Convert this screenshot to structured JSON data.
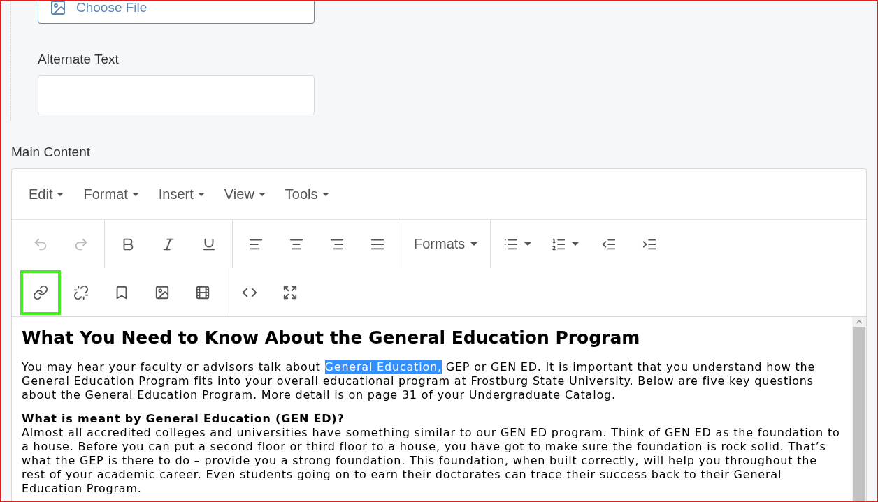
{
  "image_field": {
    "button": "Choose File"
  },
  "alt_text": {
    "label": "Alternate Text"
  },
  "main_content": {
    "label": "Main Content",
    "menubar": [
      {
        "label": "Edit"
      },
      {
        "label": "Format"
      },
      {
        "label": "Insert"
      },
      {
        "label": "View"
      },
      {
        "label": "Tools"
      }
    ],
    "toolbar_rows": [
      [
        [
          {
            "kind": "undo",
            "disabled": true,
            "highlighted": false
          },
          {
            "kind": "redo",
            "disabled": true,
            "highlighted": false
          }
        ],
        [
          {
            "kind": "bold",
            "disabled": false,
            "highlighted": false
          },
          {
            "kind": "italic",
            "disabled": false,
            "highlighted": false
          },
          {
            "kind": "underline",
            "disabled": false,
            "highlighted": false
          }
        ],
        [
          {
            "kind": "align-left",
            "disabled": false,
            "highlighted": false
          },
          {
            "kind": "align-center",
            "disabled": false,
            "highlighted": false
          },
          {
            "kind": "align-right",
            "disabled": false,
            "highlighted": false
          },
          {
            "kind": "align-justify",
            "disabled": false,
            "highlighted": false
          }
        ],
        [
          {
            "kind": "dropdown",
            "label": "Formats",
            "disabled": false,
            "highlighted": false
          }
        ],
        [
          {
            "kind": "bullet-list",
            "disabled": false,
            "highlighted": false
          },
          {
            "kind": "numbered-list",
            "disabled": false,
            "highlighted": false
          },
          {
            "kind": "outdent",
            "disabled": false,
            "highlighted": false
          },
          {
            "kind": "indent",
            "disabled": false,
            "highlighted": false
          }
        ]
      ],
      [
        [
          {
            "kind": "link",
            "disabled": false,
            "highlighted": true
          },
          {
            "kind": "unlink",
            "disabled": false,
            "highlighted": false
          },
          {
            "kind": "bookmark",
            "disabled": false,
            "highlighted": false
          },
          {
            "kind": "image",
            "disabled": false,
            "highlighted": false
          },
          {
            "kind": "video",
            "disabled": false,
            "highlighted": false
          }
        ],
        [
          {
            "kind": "code",
            "disabled": false,
            "highlighted": false
          },
          {
            "kind": "fullscreen",
            "disabled": false,
            "highlighted": false
          }
        ]
      ]
    ],
    "document": [
      {
        "kind": "heading",
        "text": "What You Need to Know About the General Education Program"
      },
      {
        "kind": "paragraph",
        "runs": [
          {
            "text": "You may hear your faculty or advisors talk about ",
            "selected": false
          },
          {
            "text": "General Education,",
            "selected": true
          },
          {
            "text": " GEP or GEN ED. It is important that you understand how the General Education Program fits into your overall educational program at Frostburg State University. Below are five key questions about the General Education Program. More detail is on page 31 of your Undergraduate Catalog.",
            "selected": false
          }
        ]
      },
      {
        "kind": "question",
        "title": "What is meant by General Education (GEN ED)?",
        "text": "Almost all accredited colleges and universities have something similar to our GEN ED program. Think of GEN ED as the foundation to a house. Before you can put a second floor or third floor to a house, you have got to make sure the foundation is rock solid. That’s what the GEP is there to do – provide you a strong foundation. This foundation, when built correctly, will help you throughout the rest of your academic career. Even students going on to earn their doctorates can trace their success back to their General Education Program."
      }
    ]
  }
}
